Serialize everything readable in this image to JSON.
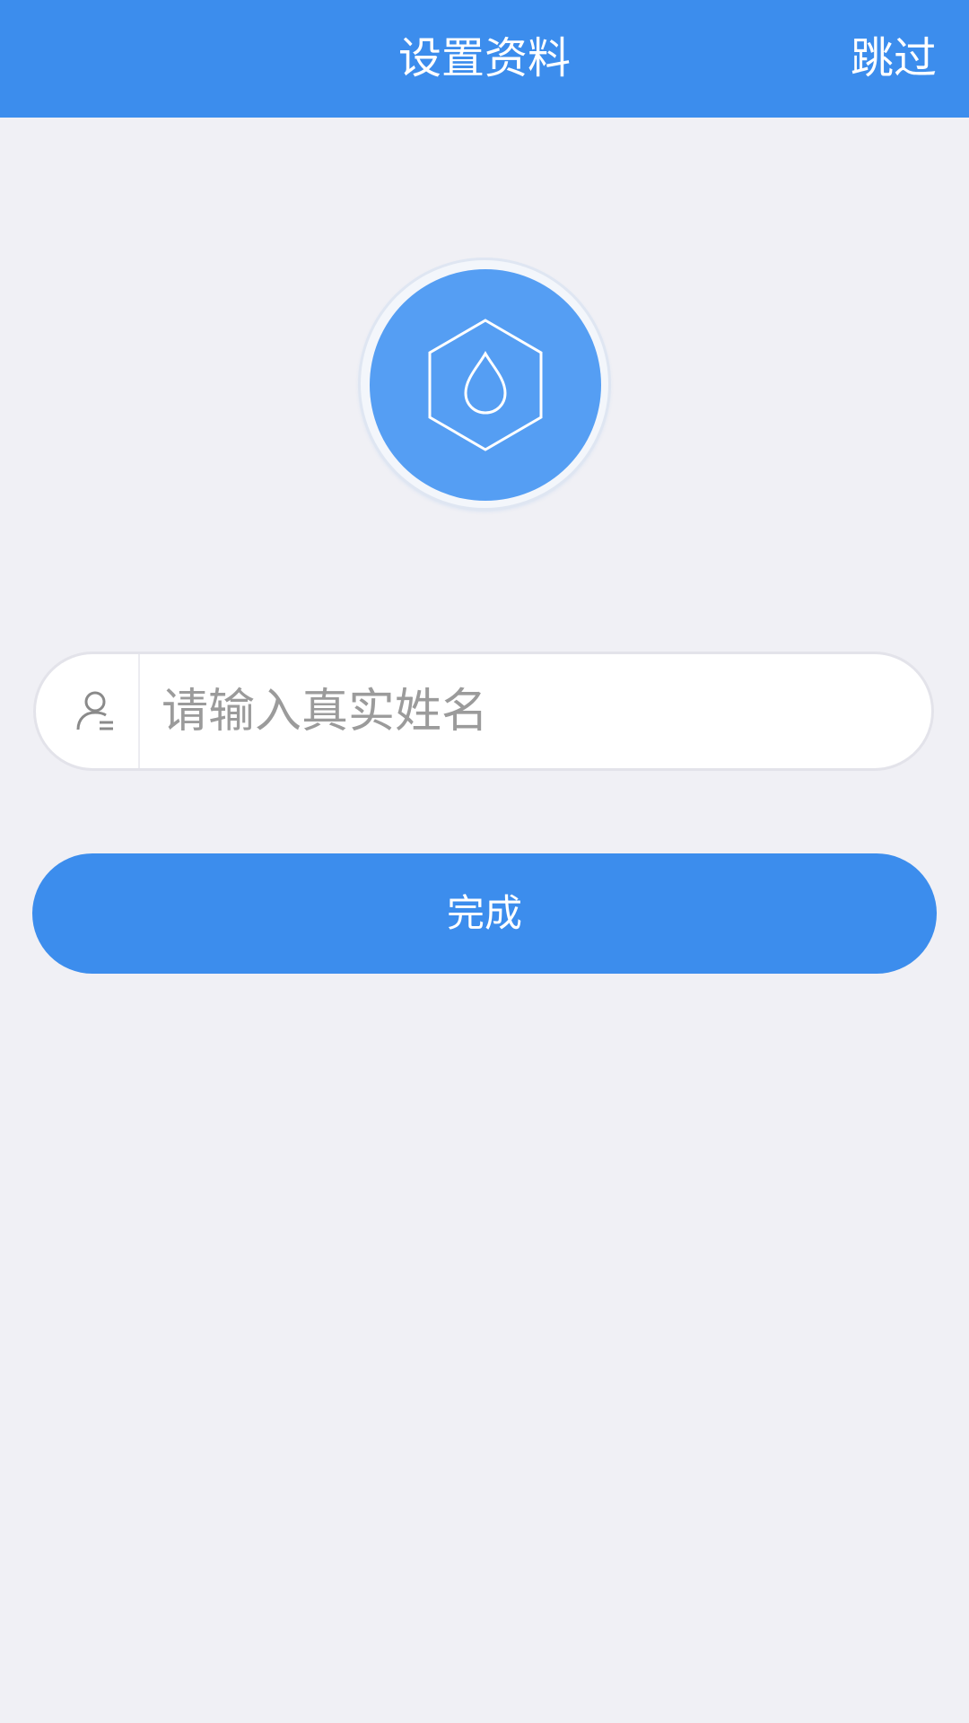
{
  "header": {
    "title": "设置资料",
    "skip_label": "跳过"
  },
  "avatar": {
    "icon": "hexagon-water-drop-icon"
  },
  "form": {
    "name_field": {
      "value": "",
      "placeholder": "请输入真实姓名",
      "icon": "user-icon"
    },
    "submit_label": "完成"
  },
  "colors": {
    "primary": "#3c8ded",
    "avatar_bg": "#559ef3",
    "page_bg": "#f0f0f5",
    "placeholder": "#9b9b9b"
  }
}
